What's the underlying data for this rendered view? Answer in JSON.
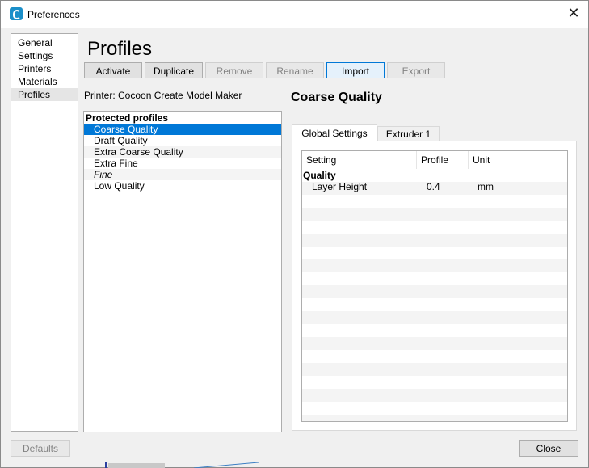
{
  "window": {
    "title": "Preferences",
    "close_glyph": "✕"
  },
  "nav": {
    "items": [
      "General",
      "Settings",
      "Printers",
      "Materials",
      "Profiles"
    ],
    "selected": "Profiles"
  },
  "page": {
    "title": "Profiles"
  },
  "toolbar": {
    "activate": "Activate",
    "duplicate": "Duplicate",
    "remove": "Remove",
    "rename": "Rename",
    "import": "Import",
    "export": "Export"
  },
  "printer_label": "Printer: Cocoon Create Model Maker",
  "profiles": {
    "section_header": "Protected profiles",
    "items": [
      "Coarse Quality",
      "Draft Quality",
      "Extra Coarse Quality",
      "Extra Fine",
      "Fine",
      "Low Quality"
    ],
    "selected": "Coarse Quality"
  },
  "detail": {
    "title": "Coarse Quality",
    "tabs": [
      "Global Settings",
      "Extruder 1"
    ],
    "active_tab": "Global Settings",
    "columns": [
      "Setting",
      "Profile",
      "Unit"
    ],
    "group": "Quality",
    "rows": [
      {
        "setting": "Layer Height",
        "profile": "0.4",
        "unit": "mm"
      }
    ]
  },
  "footer": {
    "defaults": "Defaults",
    "close": "Close"
  },
  "colors": {
    "selection": "#0078d7",
    "app_icon": "#1b8fc9"
  },
  "icons": {
    "app": "cura-app-icon",
    "close": "close-icon"
  }
}
